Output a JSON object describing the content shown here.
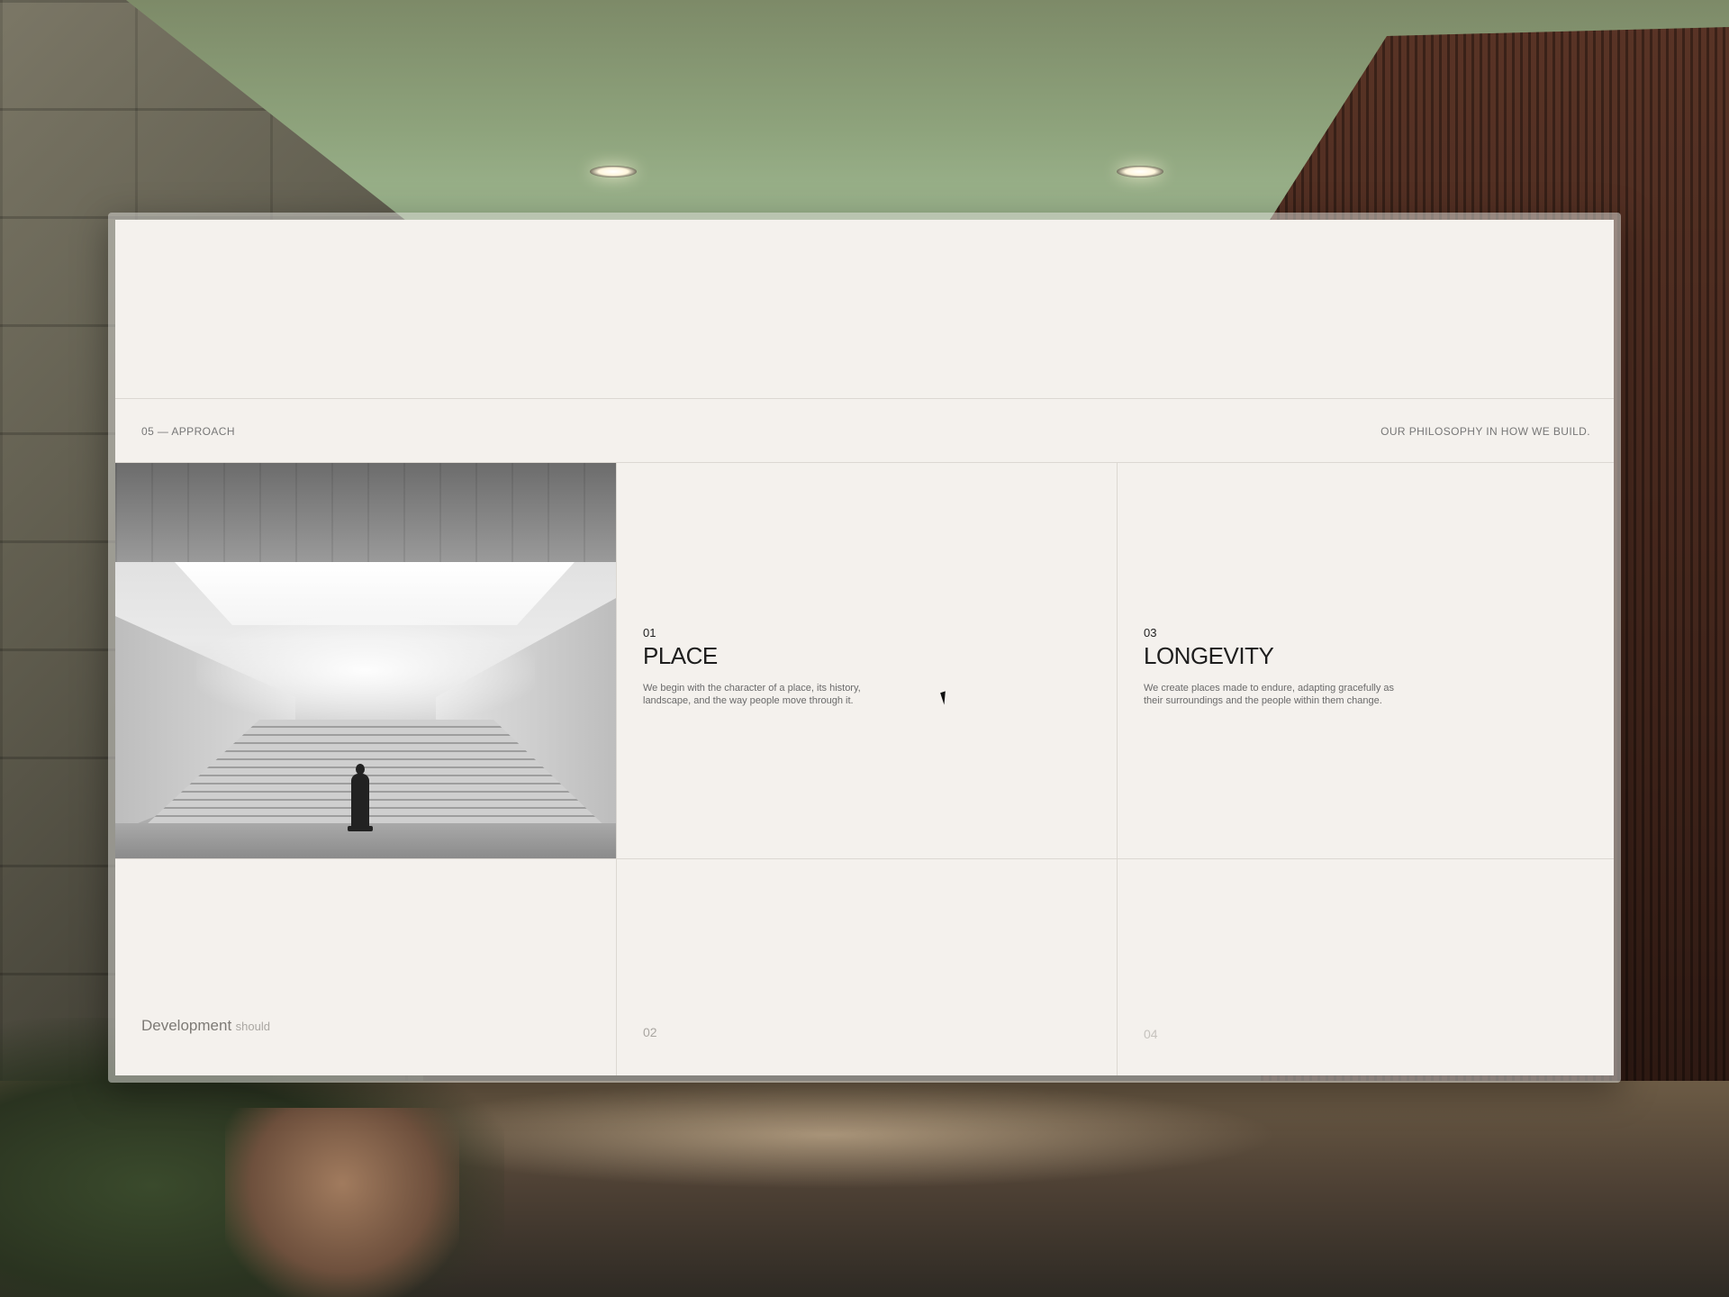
{
  "section": {
    "label": "05 — APPROACH",
    "tagline": "OUR PHILOSOPHY IN HOW WE BUILD."
  },
  "image": {
    "icon": "architecture-photo"
  },
  "items": [
    {
      "number": "01",
      "title": "PLACE",
      "description": "We begin with the character of a place, its history, landscape, and the way people move through it."
    },
    {
      "number": "03",
      "title": "LONGEVITY",
      "description": "We create places made to endure, adapting gracefully as their surroundings and the people within them change."
    }
  ],
  "statement": {
    "strong": "Development",
    "weak": "should"
  },
  "faded_numbers": {
    "second": "02",
    "fourth": "04"
  },
  "cursor": {
    "icon": "mouse-pointer-icon"
  }
}
